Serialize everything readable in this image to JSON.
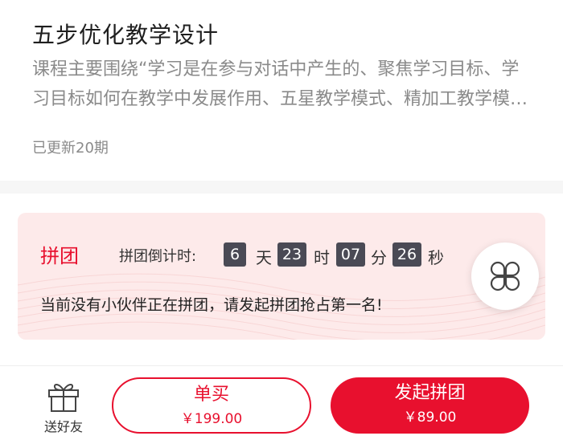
{
  "course": {
    "title": "五步优化教学设计",
    "description": "课程主要围绕“学习是在参与对话中产生的、聚焦学习目标、学习目标如何在教学中发展作用、五星教学模式、精加工教学模式等内容展开",
    "update_info": "已更新20期"
  },
  "group_buy": {
    "title": "拼团",
    "countdown_label": "拼团倒计时:",
    "days": "6",
    "days_unit": "天",
    "hours": "23",
    "hours_unit": "时",
    "minutes": "07",
    "minutes_unit": "分",
    "seconds": "26",
    "seconds_unit": "秒",
    "empty_message": "当前没有小伙伴正在拼团，请发起拼团抢占第一名!"
  },
  "floating": {
    "icon": "grid-menu-icon"
  },
  "bottom_bar": {
    "gift_label": "送好友",
    "single_label": "单买",
    "single_price": "￥199.00",
    "group_label": "发起拼团",
    "group_price": "￥89.00"
  },
  "colors": {
    "accent": "#e8102e",
    "panel_bg": "#fdeaea",
    "countdown_box": "#4a4a55",
    "muted_text": "#8a8a8a"
  }
}
